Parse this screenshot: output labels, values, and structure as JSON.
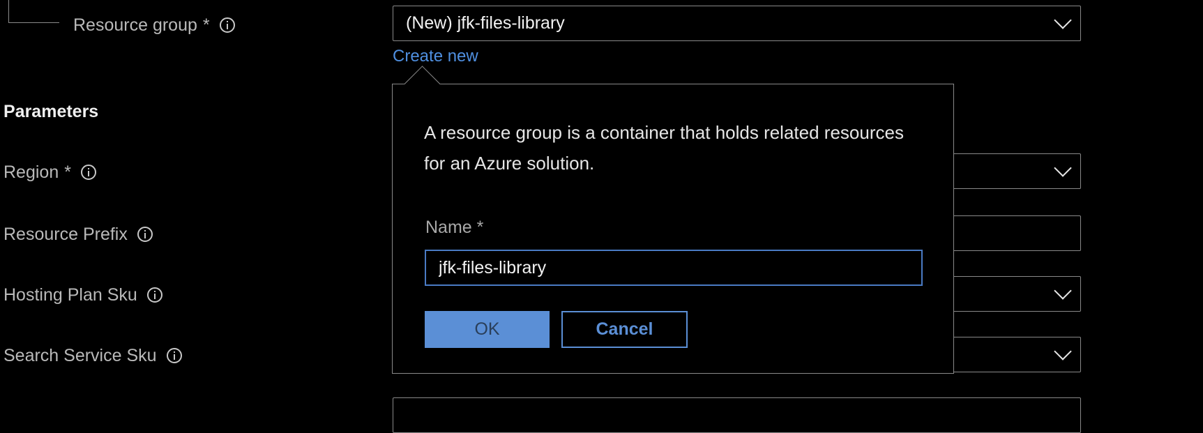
{
  "resource_group": {
    "label": "Resource group",
    "required_mark": "*",
    "value": "(New) jfk-files-library",
    "create_new_link": "Create new"
  },
  "parameters": {
    "heading": "Parameters",
    "fields": [
      {
        "label": "Region",
        "required_mark": "*",
        "kind": "dropdown",
        "value": ""
      },
      {
        "label": "Resource Prefix",
        "required_mark": "",
        "kind": "text",
        "value": ""
      },
      {
        "label": "Hosting Plan Sku",
        "required_mark": "",
        "kind": "dropdown",
        "value": ""
      },
      {
        "label": "Search Service Sku",
        "required_mark": "",
        "kind": "dropdown",
        "value": ""
      }
    ]
  },
  "create_new_popover": {
    "description": "A resource group is a container that holds related resources for an Azure solution.",
    "name_label": "Name *",
    "name_value": "jfk-files-library",
    "ok_label": "OK",
    "cancel_label": "Cancel"
  },
  "colors": {
    "background": "#000000",
    "accent": "#5b8fd6",
    "link": "#4f8fe0"
  },
  "icons": [
    "info-icon",
    "chevron-down-icon"
  ]
}
